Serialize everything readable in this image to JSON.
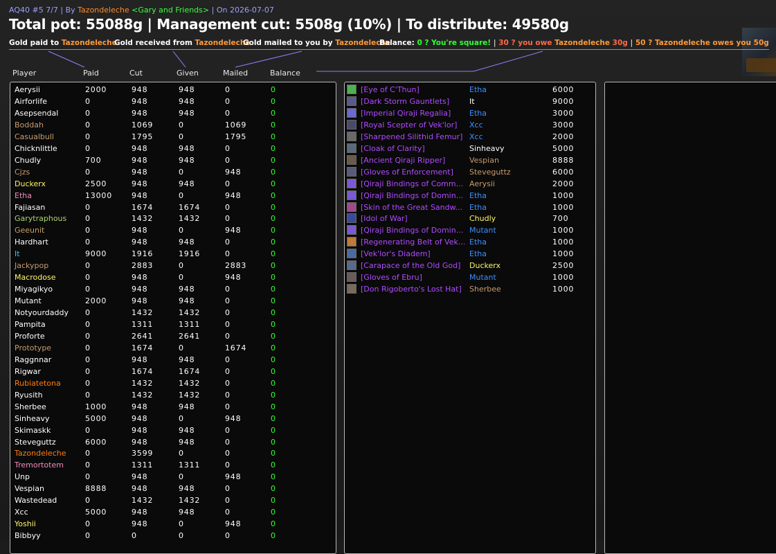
{
  "header": {
    "subtitle_prefix": "AQ40 #5 7/7 | By ",
    "author": "Tazondeleche",
    "guild": "<Gary and Friends>",
    "subtitle_suffix": " | On 2026-07-07",
    "title": "Total pot: 55088g | Management cut: 5508g (10%) | To distribute: 49580g"
  },
  "legend": {
    "paid_prefix": "Gold paid to ",
    "paid_name": "Tazondeleche",
    "received_prefix": "Gold received from ",
    "received_name": "Tazondeleche",
    "mailed_prefix": "Gold mailed to you by ",
    "mailed_name": "Tazondeleche",
    "balance_label": "Balance:",
    "balance_square": "0 ? You're square!",
    "sep": "|",
    "balance_owe_prefix": "30 ? you owe ",
    "balance_owe_name": "Tazondeleche",
    "balance_owe_suffix": " 30g",
    "balance_owed_text": "50 ? Tazondeleche owes you 50g"
  },
  "columns": {
    "player": "Player",
    "paid": "Paid",
    "cut": "Cut",
    "given": "Given",
    "mailed": "Mailed",
    "balance": "Balance"
  },
  "colors": {
    "accent_line": "#8b83ff",
    "balance_green": "#33ff33",
    "epic_item": "#b04bff",
    "gold_name": "#ff8a2a"
  },
  "players": [
    {
      "name": "Aerysii",
      "color": "#ffffff",
      "paid": "2000",
      "cut": "948",
      "given": "948",
      "mailed": "0",
      "balance": "0"
    },
    {
      "name": "Airforlife",
      "color": "#ffffff",
      "paid": "0",
      "cut": "948",
      "given": "948",
      "mailed": "0",
      "balance": "0"
    },
    {
      "name": "Asepsendal",
      "color": "#ffffff",
      "paid": "0",
      "cut": "948",
      "given": "948",
      "mailed": "0",
      "balance": "0"
    },
    {
      "name": "Boddah",
      "color": "#c79c6e",
      "paid": "0",
      "cut": "1069",
      "given": "0",
      "mailed": "1069",
      "balance": "0"
    },
    {
      "name": "Casualbull",
      "color": "#c79c6e",
      "paid": "0",
      "cut": "1795",
      "given": "0",
      "mailed": "1795",
      "balance": "0"
    },
    {
      "name": "Chicknlittle",
      "color": "#ffffff",
      "paid": "0",
      "cut": "948",
      "given": "948",
      "mailed": "0",
      "balance": "0"
    },
    {
      "name": "Chudly",
      "color": "#ffffff",
      "paid": "700",
      "cut": "948",
      "given": "948",
      "mailed": "0",
      "balance": "0"
    },
    {
      "name": "Cjzs",
      "color": "#c79c6e",
      "paid": "0",
      "cut": "948",
      "given": "0",
      "mailed": "948",
      "balance": "0"
    },
    {
      "name": "Duckerx",
      "color": "#fff569",
      "paid": "2500",
      "cut": "948",
      "given": "948",
      "mailed": "0",
      "balance": "0"
    },
    {
      "name": "Etha",
      "color": "#f58cba",
      "paid": "13000",
      "cut": "948",
      "given": "0",
      "mailed": "948",
      "balance": "0"
    },
    {
      "name": "Fajiasan",
      "color": "#ffffff",
      "paid": "0",
      "cut": "1674",
      "given": "1674",
      "mailed": "0",
      "balance": "0"
    },
    {
      "name": "Garytraphous",
      "color": "#abd473",
      "paid": "0",
      "cut": "1432",
      "given": "1432",
      "mailed": "0",
      "balance": "0"
    },
    {
      "name": "Geeunit",
      "color": "#c79c6e",
      "paid": "0",
      "cut": "948",
      "given": "0",
      "mailed": "948",
      "balance": "0"
    },
    {
      "name": "Hardhart",
      "color": "#ffffff",
      "paid": "0",
      "cut": "948",
      "given": "948",
      "mailed": "0",
      "balance": "0"
    },
    {
      "name": "It",
      "color": "#3fc7eb",
      "paid": "9000",
      "cut": "1916",
      "given": "1916",
      "mailed": "0",
      "balance": "0"
    },
    {
      "name": "Jackypop",
      "color": "#c79c6e",
      "paid": "0",
      "cut": "2883",
      "given": "0",
      "mailed": "2883",
      "balance": "0"
    },
    {
      "name": "Macrodose",
      "color": "#fff569",
      "paid": "0",
      "cut": "948",
      "given": "0",
      "mailed": "948",
      "balance": "0"
    },
    {
      "name": "Miyagikyo",
      "color": "#ffffff",
      "paid": "0",
      "cut": "948",
      "given": "948",
      "mailed": "0",
      "balance": "0"
    },
    {
      "name": "Mutant",
      "color": "#ffffff",
      "paid": "2000",
      "cut": "948",
      "given": "948",
      "mailed": "0",
      "balance": "0"
    },
    {
      "name": "Notyourdaddy",
      "color": "#ffffff",
      "paid": "0",
      "cut": "1432",
      "given": "1432",
      "mailed": "0",
      "balance": "0"
    },
    {
      "name": "Pampita",
      "color": "#ffffff",
      "paid": "0",
      "cut": "1311",
      "given": "1311",
      "mailed": "0",
      "balance": "0"
    },
    {
      "name": "Proforte",
      "color": "#ffffff",
      "paid": "0",
      "cut": "2641",
      "given": "2641",
      "mailed": "0",
      "balance": "0"
    },
    {
      "name": "Prototype",
      "color": "#c79c6e",
      "paid": "0",
      "cut": "1674",
      "given": "0",
      "mailed": "1674",
      "balance": "0"
    },
    {
      "name": "Raggnnar",
      "color": "#ffffff",
      "paid": "0",
      "cut": "948",
      "given": "948",
      "mailed": "0",
      "balance": "0"
    },
    {
      "name": "Rigwar",
      "color": "#ffffff",
      "paid": "0",
      "cut": "1674",
      "given": "1674",
      "mailed": "0",
      "balance": "0"
    },
    {
      "name": "Rubiatetona",
      "color": "#ff7d0a",
      "paid": "0",
      "cut": "1432",
      "given": "1432",
      "mailed": "0",
      "balance": "0"
    },
    {
      "name": "Ryusith",
      "color": "#ffffff",
      "paid": "0",
      "cut": "1432",
      "given": "1432",
      "mailed": "0",
      "balance": "0"
    },
    {
      "name": "Sherbee",
      "color": "#ffffff",
      "paid": "1000",
      "cut": "948",
      "given": "948",
      "mailed": "0",
      "balance": "0"
    },
    {
      "name": "Sinheavy",
      "color": "#ffffff",
      "paid": "5000",
      "cut": "948",
      "given": "0",
      "mailed": "948",
      "balance": "0"
    },
    {
      "name": "Skimaskk",
      "color": "#ffffff",
      "paid": "0",
      "cut": "948",
      "given": "948",
      "mailed": "0",
      "balance": "0"
    },
    {
      "name": "Steveguttz",
      "color": "#ffffff",
      "paid": "6000",
      "cut": "948",
      "given": "948",
      "mailed": "0",
      "balance": "0"
    },
    {
      "name": "Tazondeleche",
      "color": "#ff7d0a",
      "paid": "0",
      "cut": "3599",
      "given": "0",
      "mailed": "0",
      "balance": "0"
    },
    {
      "name": "Tremortotem",
      "color": "#f58cba",
      "paid": "0",
      "cut": "1311",
      "given": "1311",
      "mailed": "0",
      "balance": "0"
    },
    {
      "name": "Unp",
      "color": "#ffffff",
      "paid": "0",
      "cut": "948",
      "given": "0",
      "mailed": "948",
      "balance": "0"
    },
    {
      "name": "Vespian",
      "color": "#ffffff",
      "paid": "8888",
      "cut": "948",
      "given": "948",
      "mailed": "0",
      "balance": "0"
    },
    {
      "name": "Wastedead",
      "color": "#ffffff",
      "paid": "0",
      "cut": "1432",
      "given": "1432",
      "mailed": "0",
      "balance": "0"
    },
    {
      "name": "Xcc",
      "color": "#ffffff",
      "paid": "5000",
      "cut": "948",
      "given": "948",
      "mailed": "0",
      "balance": "0"
    },
    {
      "name": "Yoshii",
      "color": "#fff569",
      "paid": "0",
      "cut": "948",
      "given": "0",
      "mailed": "948",
      "balance": "0"
    },
    {
      "name": "Bibbyy",
      "color": "#ffffff",
      "paid": "0",
      "cut": "0",
      "given": "0",
      "mailed": "0",
      "balance": "0"
    }
  ],
  "items": [
    {
      "item": "[Eye of C'Thun]",
      "icon_color": "#4fb04f",
      "winner": "Etha",
      "winner_color": "#3f8fff",
      "price": "6000"
    },
    {
      "item": "[Dark Storm Gauntlets]",
      "icon_color": "#5a5a8a",
      "winner": "It",
      "winner_color": "#ffffff",
      "price": "9000"
    },
    {
      "item": "[Imperial Qiraji Regalia]",
      "icon_color": "#6a6ad0",
      "winner": "Etha",
      "winner_color": "#3f8fff",
      "price": "3000"
    },
    {
      "item": "[Royal Scepter of Vek'lor]",
      "icon_color": "#4a4a6a",
      "winner": "Xcc",
      "winner_color": "#3f8fff",
      "price": "3000"
    },
    {
      "item": "[Sharpened Silithid Femur]",
      "icon_color": "#6a6a6a",
      "winner": "Xcc",
      "winner_color": "#3f8fff",
      "price": "2000"
    },
    {
      "item": "[Cloak of Clarity]",
      "icon_color": "#5a6a7a",
      "winner": "Sinheavy",
      "winner_color": "#ffffff",
      "price": "5000"
    },
    {
      "item": "[Ancient Qiraji Ripper]",
      "icon_color": "#6a5a4a",
      "winner": "Vespian",
      "winner_color": "#c79c6e",
      "price": "8888"
    },
    {
      "item": "[Gloves of Enforcement]",
      "icon_color": "#5a5a7a",
      "winner": "Steveguttz",
      "winner_color": "#c79c6e",
      "price": "6000"
    },
    {
      "item": "[Qiraji Bindings of Comm...",
      "icon_color": "#7a5ad0",
      "winner": "Aerysii",
      "winner_color": "#c79c6e",
      "price": "2000"
    },
    {
      "item": "[Qiraji Bindings of Domin...",
      "icon_color": "#7a5ad0",
      "winner": "Etha",
      "winner_color": "#3f8fff",
      "price": "1000"
    },
    {
      "item": "[Skin of the Great Sandw...",
      "icon_color": "#a04a8a",
      "winner": "Etha",
      "winner_color": "#3f8fff",
      "price": "1000"
    },
    {
      "item": "[Idol of War]",
      "icon_color": "#3a4a9a",
      "winner": "Chudly",
      "winner_color": "#fff569",
      "price": "700"
    },
    {
      "item": "[Qiraji Bindings of Domin...",
      "icon_color": "#7a5ad0",
      "winner": "Mutant",
      "winner_color": "#3f8fff",
      "price": "1000"
    },
    {
      "item": "[Regenerating Belt of Vek...",
      "icon_color": "#c07a3a",
      "winner": "Etha",
      "winner_color": "#3f8fff",
      "price": "1000"
    },
    {
      "item": "[Vek'lor's Diadem]",
      "icon_color": "#4a6aa0",
      "winner": "Etha",
      "winner_color": "#3f8fff",
      "price": "1000"
    },
    {
      "item": "[Carapace of the Old God]",
      "icon_color": "#5a6a8a",
      "winner": "Duckerx",
      "winner_color": "#fff569",
      "price": "2500"
    },
    {
      "item": "[Gloves of Ebru]",
      "icon_color": "#6a5a5a",
      "winner": "Mutant",
      "winner_color": "#3f8fff",
      "price": "1000"
    },
    {
      "item": "[Don Rigoberto's Lost Hat]",
      "icon_color": "#7a6a5a",
      "winner": "Sherbee",
      "winner_color": "#c79c6e",
      "price": "1000"
    }
  ]
}
